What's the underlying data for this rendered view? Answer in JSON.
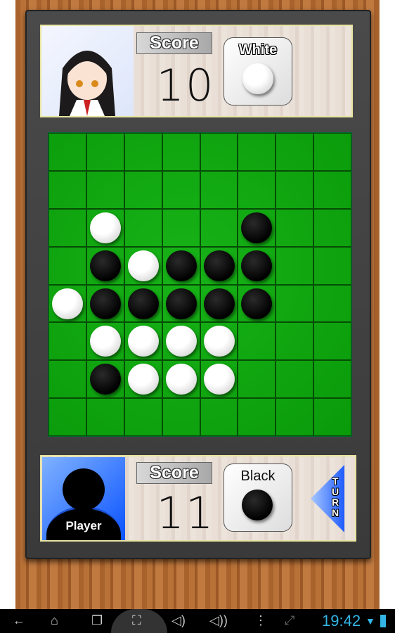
{
  "opponent": {
    "score_label": "Score",
    "score": "10",
    "color_label": "White",
    "color": "white"
  },
  "player": {
    "name": "Player",
    "score_label": "Score",
    "score": "11",
    "color_label": "Black",
    "color": "black",
    "turn_label": "TURN"
  },
  "board": [
    "........",
    "........",
    ".W...B..",
    ".BWBBB..",
    "WBBBBB..",
    ".WWWW...",
    ".BWWW...",
    "........"
  ],
  "colors": {
    "board": "#0fa80f",
    "turn_arrow": "#2a6cff",
    "clock": "#33b5e5"
  },
  "status_bar": {
    "time": "19:42",
    "icons": [
      "back-icon",
      "home-icon",
      "recent-apps-icon",
      "screenshot-icon",
      "volume-down-icon",
      "volume-up-icon",
      "menu-icon",
      "fullscreen-icon",
      "wifi-icon",
      "battery-icon"
    ]
  }
}
